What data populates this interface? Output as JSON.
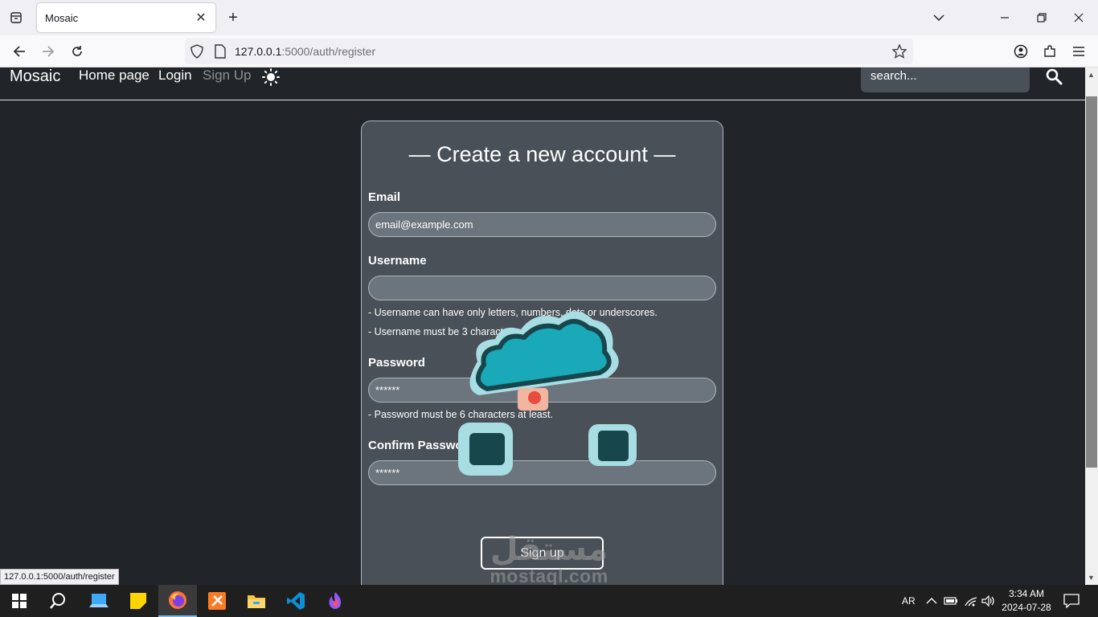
{
  "browser": {
    "tab_title": "Mosaic",
    "url_host": "127.0.0.1",
    "url_path": ":5000/auth/register",
    "status_url": "127.0.0.1:5000/auth/register"
  },
  "site": {
    "brand": "Mosaic",
    "nav": {
      "home": "Home page",
      "login": "Login",
      "signup": "Sign Up"
    },
    "search_placeholder": "search..."
  },
  "form": {
    "title": "— Create a new account —",
    "email_label": "Email",
    "email_placeholder": "email@example.com",
    "username_label": "Username",
    "username_hint_1": "- Username can have only letters, numbers, dots or underscores.",
    "username_hint_2": "- Username must be 3 characters at least.",
    "password_label": "Password",
    "password_placeholder": "******",
    "password_hint": "- Password must be 6 characters at least.",
    "confirm_label": "Confirm Password",
    "confirm_placeholder": "******",
    "submit": "Sign up"
  },
  "watermark": {
    "arabic": "مستقل",
    "latin": "mostaql.com"
  },
  "taskbar": {
    "lang": "AR",
    "time": "3:34 AM",
    "date": "2024-07-28"
  },
  "colors": {
    "page_bg": "#212529",
    "card_bg": "#495057",
    "input_bg": "#6c757d",
    "taskbar_bg": "#1f1f1f",
    "sticker_teal": "#1aa9b8"
  }
}
